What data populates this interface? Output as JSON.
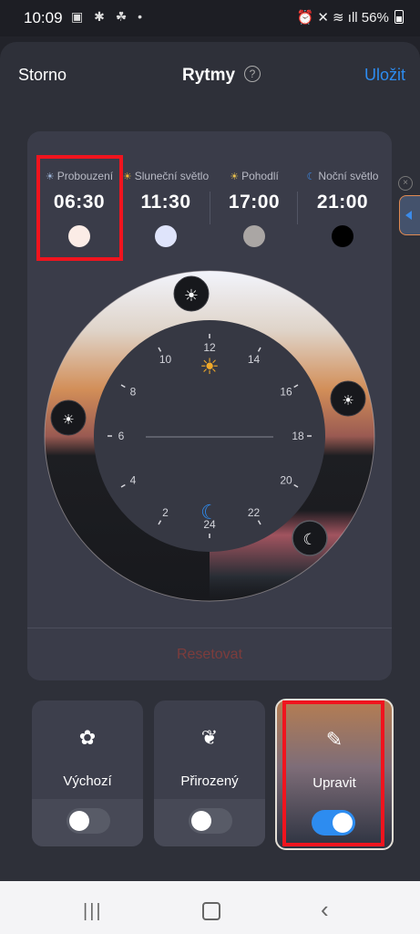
{
  "status_bar": {
    "time": "10:09",
    "notif_icons": "▣ ✱ ☘ •",
    "right_icons": "⏰ ✕ ≋ ıll",
    "battery": "56%"
  },
  "header": {
    "cancel": "Storno",
    "title": "Rytmy",
    "help": "?",
    "save": "Uložit"
  },
  "schedule": [
    {
      "label": "Probouzení",
      "time": "06:30",
      "icon": "sunrise-icon",
      "glyph": "☀",
      "dot_color": "#fbece6"
    },
    {
      "label": "Sluneční světlo",
      "time": "11:30",
      "icon": "sun-icon",
      "glyph": "☀",
      "dot_color": "#dfe4fb"
    },
    {
      "label": "Pohodlí",
      "time": "17:00",
      "icon": "sunset-icon",
      "glyph": "☀",
      "dot_color": "#aaa6a4"
    },
    {
      "label": "Noční světlo",
      "time": "21:00",
      "icon": "moon-icon",
      "glyph": "☾",
      "dot_color": "#000000"
    }
  ],
  "dial": {
    "hour_labels": [
      "12",
      "14",
      "16",
      "18",
      "20",
      "22",
      "24",
      "2",
      "4",
      "6",
      "8",
      "10"
    ]
  },
  "reset": "Resetovat",
  "modes": [
    {
      "label": "Výchozí",
      "icon": "gear-icon",
      "glyph": "✿",
      "on": false
    },
    {
      "label": "Přirozený",
      "icon": "leaf-icon",
      "glyph": "❦",
      "on": false
    },
    {
      "label": "Upravit",
      "icon": "pencil-icon",
      "glyph": "✎",
      "on": true
    }
  ],
  "colors": {
    "accent": "#2d8cf0",
    "highlight": "#f0141e"
  },
  "nav_bar": {
    "recent": "|||",
    "back": "‹"
  }
}
